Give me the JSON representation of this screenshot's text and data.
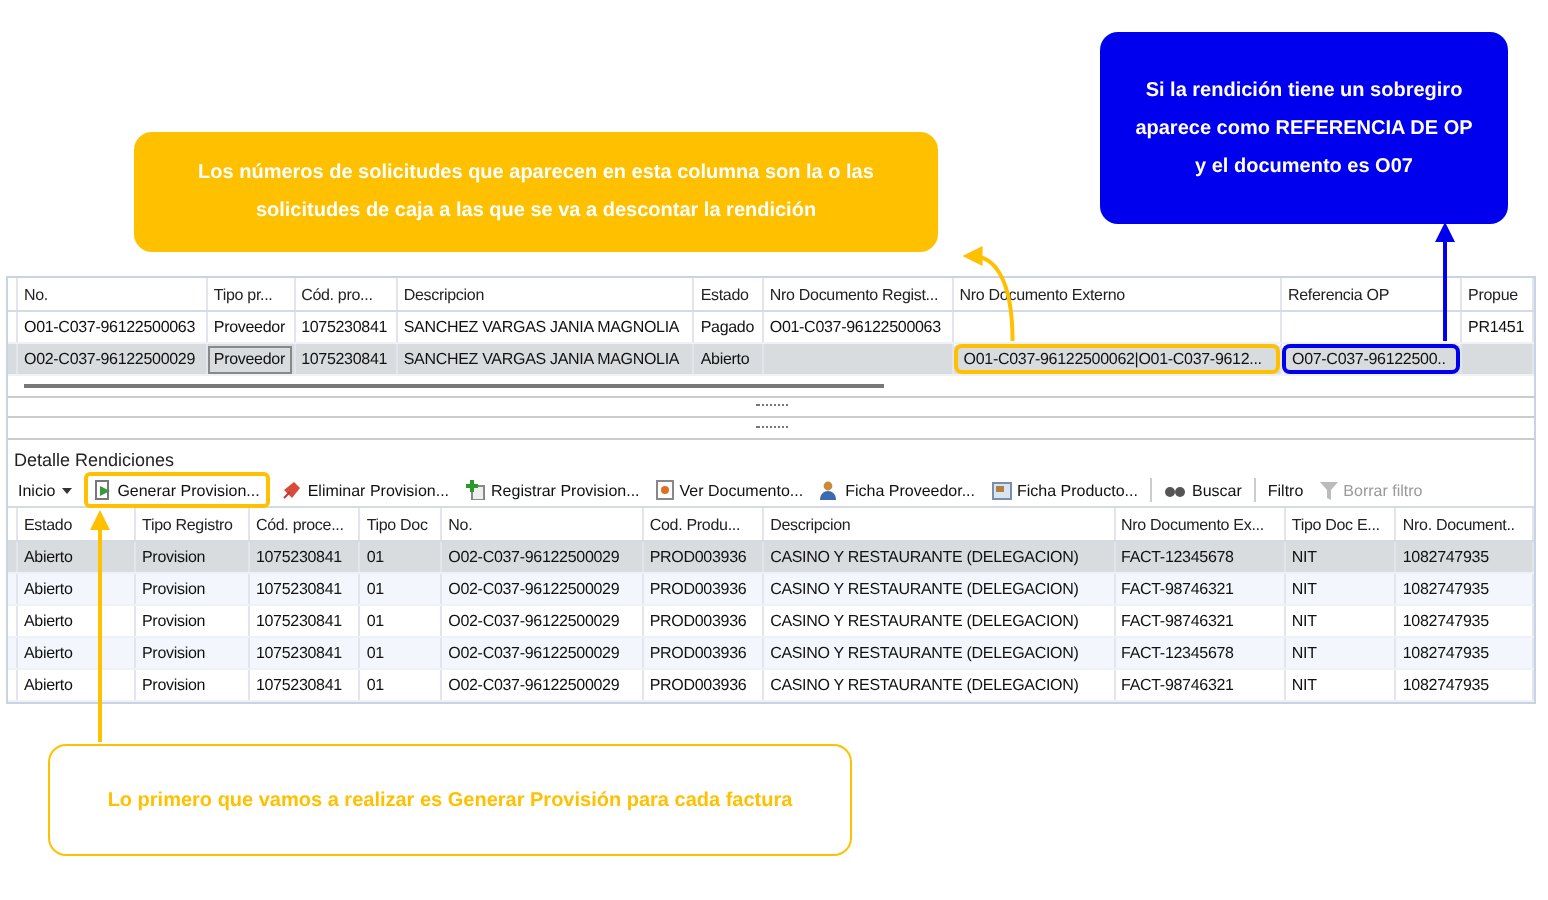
{
  "callouts": [
    {
      "text": "Los números de solicitudes que aparecen en esta columna son la o las solicitudes de caja a las que se va a descontar la rendición",
      "color": "#ffc000",
      "kind": "filled"
    },
    {
      "text": "Si la rendición tiene un sobregiro aparece como REFERENCIA DE OP y el documento es O07",
      "color": "#0000ee",
      "kind": "filled"
    },
    {
      "text": "Lo primero que vamos a realizar es Generar Provisión para cada factura",
      "color": "#ffc000",
      "kind": "outlined"
    }
  ],
  "top_grid": {
    "columns": [
      "No.",
      "Tipo pr...",
      "Cód. pro...",
      "Descripcion",
      "Estado",
      "Nro Documento Regist...",
      "Nro Documento Externo",
      "Referencia OP",
      "Propue"
    ],
    "rows": [
      {
        "selected": false,
        "cells": [
          "O01-C037-96122500063",
          "Proveedor",
          "1075230841",
          "SANCHEZ VARGAS JANIA MAGNOLIA",
          "Pagado",
          "O01-C037-96122500063",
          "",
          "",
          "PR1451"
        ]
      },
      {
        "selected": true,
        "cells": [
          "O02-C037-96122500029",
          "Proveedor",
          "1075230841",
          "SANCHEZ VARGAS JANIA MAGNOLIA",
          "Abierto",
          "",
          "O01-C037-96122500062|O01-C037-9612...",
          "O07-C037-96122500..",
          ""
        ]
      }
    ]
  },
  "detail": {
    "title": "Detalle Rendiciones",
    "toolbar": [
      {
        "kind": "menu",
        "label": "Inicio",
        "disabled": false
      },
      {
        "kind": "generate",
        "label": "Generar Provision...",
        "disabled": false
      },
      {
        "kind": "delete",
        "label": "Eliminar Provision...",
        "disabled": false
      },
      {
        "kind": "register",
        "label": "Registrar Provision...",
        "disabled": false
      },
      {
        "kind": "view",
        "label": "Ver Documento...",
        "disabled": false
      },
      {
        "kind": "supplier",
        "label": "Ficha Proveedor...",
        "disabled": false
      },
      {
        "kind": "product",
        "label": "Ficha Producto...",
        "disabled": false
      },
      {
        "kind": "search",
        "label": "Buscar",
        "disabled": false
      },
      {
        "kind": "text",
        "label": "Filtro",
        "disabled": false
      },
      {
        "kind": "clear",
        "label": "Borrar filtro",
        "disabled": true
      }
    ],
    "grid": {
      "columns": [
        "Estado",
        "Tipo Registro",
        "Cód. proce...",
        "Tipo Doc",
        "No.",
        "Cod. Produ...",
        "Descripcion",
        "Nro Documento Ex...",
        "Tipo Doc E...",
        "Nro. Document.."
      ],
      "rows": [
        {
          "selected": true,
          "cells": [
            "Abierto",
            "Provision",
            "1075230841",
            "01",
            "O02-C037-96122500029",
            "PROD003936",
            "CASINO Y RESTAURANTE (DELEGACION)",
            "FACT-12345678",
            "NIT",
            "1082747935"
          ]
        },
        {
          "selected": false,
          "cells": [
            "Abierto",
            "Provision",
            "1075230841",
            "01",
            "O02-C037-96122500029",
            "PROD003936",
            "CASINO Y RESTAURANTE (DELEGACION)",
            "FACT-98746321",
            "NIT",
            "1082747935"
          ]
        },
        {
          "selected": false,
          "cells": [
            "Abierto",
            "Provision",
            "1075230841",
            "01",
            "O02-C037-96122500029",
            "PROD003936",
            "CASINO Y RESTAURANTE (DELEGACION)",
            "FACT-98746321",
            "NIT",
            "1082747935"
          ]
        },
        {
          "selected": false,
          "cells": [
            "Abierto",
            "Provision",
            "1075230841",
            "01",
            "O02-C037-96122500029",
            "PROD003936",
            "CASINO Y RESTAURANTE (DELEGACION)",
            "FACT-12345678",
            "NIT",
            "1082747935"
          ]
        },
        {
          "selected": false,
          "cells": [
            "Abierto",
            "Provision",
            "1075230841",
            "01",
            "O02-C037-96122500029",
            "PROD003936",
            "CASINO Y RESTAURANTE (DELEGACION)",
            "FACT-98746321",
            "NIT",
            "1082747935"
          ]
        }
      ]
    }
  }
}
